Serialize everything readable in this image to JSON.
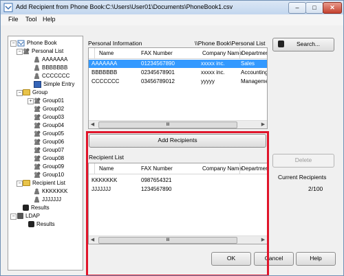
{
  "window": {
    "title": "Add Recipient from Phone Book:C:\\Users\\User01\\Documents\\PhoneBook1.csv"
  },
  "titlebar_buttons": {
    "minimize": "–",
    "maximize": "□",
    "close": "✕"
  },
  "menu": [
    "File",
    "Tool",
    "Help"
  ],
  "tree": {
    "root": "Phone Book",
    "personal_list": "Personal List",
    "persons": [
      "AAAAAAA",
      "BBBBBBB",
      "CCCCCCC"
    ],
    "simple_entry": "Simple Entry",
    "group": "Group",
    "groups": [
      "Group01",
      "Group02",
      "Group03",
      "Group04",
      "Group05",
      "Group06",
      "Group07",
      "Group08",
      "Group09",
      "Group10"
    ],
    "recipient_list": "Recipient List",
    "recipients": [
      "KKKKKKK",
      "JJJJJJJ"
    ],
    "results": "Results",
    "ldap": "LDAP",
    "ldap_results": "Results"
  },
  "personal_info": {
    "label": "Personal Information",
    "path": "\\\\Phone Book\\Personal List",
    "columns": [
      "Name",
      "FAX Number",
      "Company Name",
      "Departmer"
    ],
    "rows": [
      [
        "AAAAAAA",
        "01234567890",
        "xxxxx inc.",
        "Sales"
      ],
      [
        "BBBBBBB",
        "02345678901",
        "xxxxx inc.",
        "Accounting"
      ],
      [
        "CCCCCCC",
        "03456789012",
        "yyyyy",
        "Manageme"
      ]
    ],
    "scroll_mark": "III"
  },
  "buttons": {
    "search": "Search...",
    "add_recipients": "Add Recipients",
    "delete": "Delete",
    "ok": "OK",
    "cancel": "Cancel",
    "help": "Help"
  },
  "recipient_list": {
    "label": "Recipient List",
    "columns": [
      "Name",
      "FAX Number",
      "Company Name",
      "Departmer"
    ],
    "rows": [
      [
        "KKKKKKK",
        "0987654321",
        "",
        ""
      ],
      [
        "JJJJJJJ",
        "1234567890",
        "",
        ""
      ]
    ],
    "scroll_mark": "III"
  },
  "current_recipients": {
    "label": "Current Recipients",
    "value": "2/100"
  },
  "colors": {
    "selection": "#3399ff",
    "highlight_box": "#e0142a"
  }
}
